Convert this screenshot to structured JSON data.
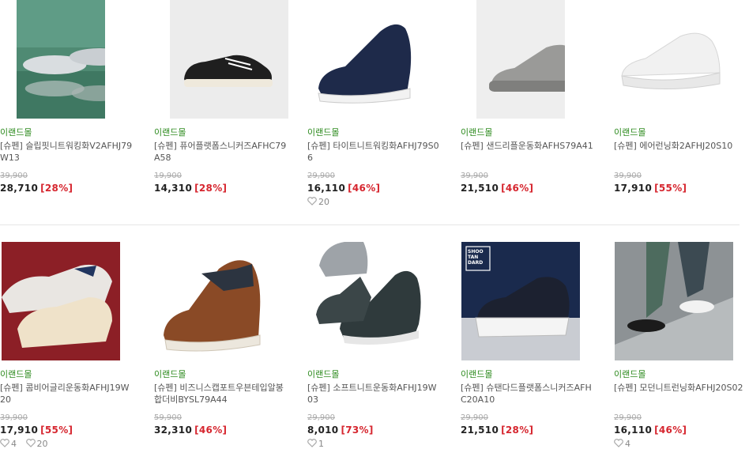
{
  "row1": [
    {
      "store": "이랜드몰",
      "name": "[슈펜] 슬립핏니트워킹화V2AFHJ79W13",
      "original_price": "39,900",
      "price": "28,710",
      "discount": "[28%]",
      "likes": []
    },
    {
      "store": "이랜드몰",
      "name": "[슈펜] 퓨어플랫폼스니커즈AFHC79A58",
      "original_price": "19,900",
      "price": "14,310",
      "discount": "[28%]",
      "likes": []
    },
    {
      "store": "이랜드몰",
      "name": "[슈펜] 타이트니트워킹화AFHJ79S06",
      "original_price": "29,900",
      "price": "16,110",
      "discount": "[46%]",
      "likes": [
        "20"
      ]
    },
    {
      "store": "이랜드몰",
      "name": "[슈펜] 샌드리플운동화AFHS79A41",
      "original_price": "39,900",
      "price": "21,510",
      "discount": "[46%]",
      "likes": []
    },
    {
      "store": "이랜드몰",
      "name": "[슈펜] 에어런닝화2AFHJ20S10",
      "original_price": "39,900",
      "price": "17,910",
      "discount": "[55%]",
      "likes": []
    }
  ],
  "row2": [
    {
      "store": "이랜드몰",
      "name": "[슈펜] 콤비어글리운동화AFHJ19W20",
      "original_price": "39,900",
      "price": "17,910",
      "discount": "[55%]",
      "likes": [
        "4",
        "20"
      ]
    },
    {
      "store": "이랜드몰",
      "name": "[슈펜] 비즈니스캡포트우븐테입알봉합더비BYSL79A44",
      "original_price": "59,900",
      "price": "32,310",
      "discount": "[46%]",
      "likes": []
    },
    {
      "store": "이랜드몰",
      "name": "[슈펜] 소프트니트운동화AFHJ19W03",
      "original_price": "29,900",
      "price": "8,010",
      "discount": "[73%]",
      "likes": [
        "1"
      ]
    },
    {
      "store": "이랜드몰",
      "name": "[슈펜] 슈탠다드플랫폼스니커즈AFHC20A10",
      "original_price": "29,900",
      "price": "21,510",
      "discount": "[28%]",
      "likes": []
    },
    {
      "store": "이랜드몰",
      "name": "[슈펜] 모던니트런닝화AFHJ20S02",
      "original_price": "29,900",
      "price": "16,110",
      "discount": "[46%]",
      "likes": [
        "4"
      ]
    }
  ],
  "shoostandard_logo": "SHOO TAN DARD",
  "colors": {
    "store": "#2e8b1f",
    "discount": "#d6262f",
    "price": "#222222",
    "orig": "#aaaaaa"
  }
}
